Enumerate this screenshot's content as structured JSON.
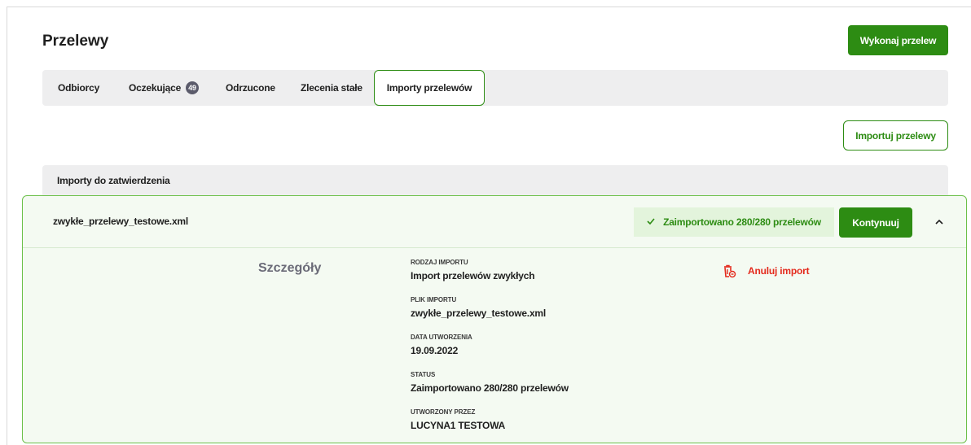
{
  "header": {
    "title": "Przelewy",
    "primary_button": "Wykonaj przelew"
  },
  "tabs": [
    {
      "label": "Odbiorcy"
    },
    {
      "label": "Oczekujące",
      "badge": "49"
    },
    {
      "label": "Odrzucone"
    },
    {
      "label": "Zlecenia stałe"
    },
    {
      "label": "Importy przelewów",
      "active": true
    }
  ],
  "actions": {
    "import_button": "Importuj przelewy"
  },
  "section": {
    "title": "Importy do zatwierdzenia"
  },
  "import_item": {
    "file_name": "zwykłe_przelewy_testowe.xml",
    "status_text": "Zaimportowano 280/280 przelewów",
    "continue_button": "Kontynuuj",
    "details_title": "Szczegóły",
    "cancel_label": "Anuluj import",
    "details": [
      {
        "label": "RODZAJ IMPORTU",
        "value": "Import przelewów zwykłych"
      },
      {
        "label": "PLIK IMPORTU",
        "value": "zwykłe_przelewy_testowe.xml"
      },
      {
        "label": "DATA UTWORZENIA",
        "value": "19.09.2022"
      },
      {
        "label": "STATUS",
        "value": "Zaimportowano 280/280 przelewów"
      },
      {
        "label": "UTWORZONY PRZEZ",
        "value": "LUCYNA1 TESTOWA"
      }
    ]
  },
  "colors": {
    "brand_green": "#2d8c13",
    "success_bg": "#e3f4dc",
    "danger": "#e42a1d"
  }
}
